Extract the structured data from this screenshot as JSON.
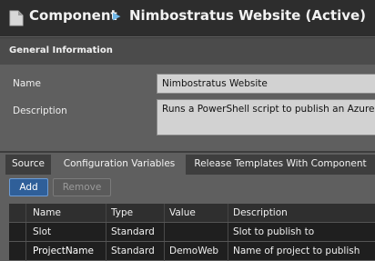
{
  "header": {
    "breadcrumb_1": "Component",
    "breadcrumb_2": "Nimbostratus Website (Active)",
    "icon": "document-icon"
  },
  "section": {
    "title": "General Information"
  },
  "form": {
    "name_label": "Name",
    "name_value": "Nimbostratus Website",
    "description_label": "Description",
    "description_value": "Runs a PowerShell script to publish an Azure"
  },
  "tabs": [
    {
      "label": "Source",
      "active": false
    },
    {
      "label": "Configuration Variables",
      "active": true
    },
    {
      "label": "Release Templates With Component",
      "active": false
    }
  ],
  "toolbar": {
    "add_label": "Add",
    "remove_label": "Remove"
  },
  "grid": {
    "columns": [
      "Name",
      "Type",
      "Value",
      "Description"
    ],
    "rows": [
      {
        "name": "Slot",
        "type": "Standard",
        "value": "",
        "description": "Slot to publish to"
      },
      {
        "name": "ProjectName",
        "type": "Standard",
        "value": "DemoWeb",
        "description": "Name of project to publish"
      }
    ]
  },
  "colors": {
    "titlebar": "#2d2d2d",
    "panel": "#5f5f5f",
    "accent": "#2f5f99",
    "breadcrumb_arrow": "#6fb7e8"
  }
}
